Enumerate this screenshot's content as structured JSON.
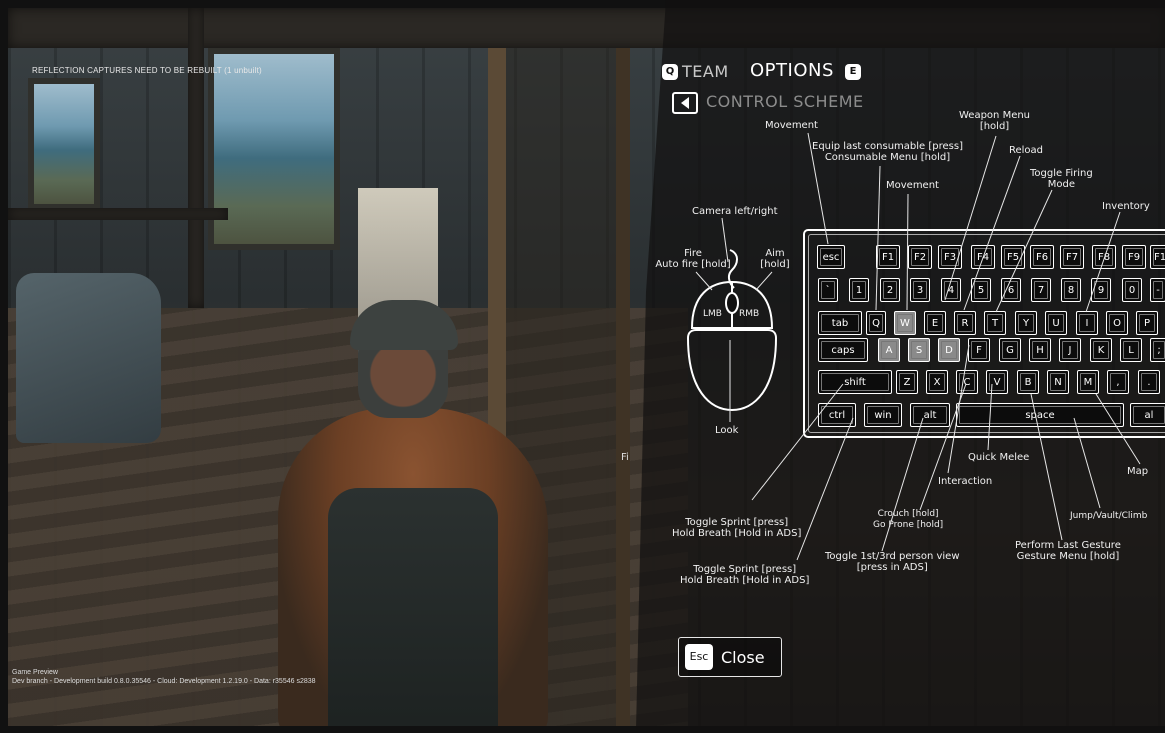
{
  "dev_overlay": {
    "top_warning": "REFLECTION CAPTURES NEED TO BE REBUILT (1 unbuilt)",
    "bottom_line1": "Game Preview",
    "bottom_line2": "Dev branch - Development build 0.8.0.35546 - Cloud: Development 1.2.19.0 - Data: r35546 s2838",
    "fragment_text": "Fi"
  },
  "header": {
    "team_key": "Q",
    "team_label": "TEAM",
    "options_label": "OPTIONS",
    "options_key": "E",
    "back_icon": "chevron-left-icon",
    "scheme_label": "CONTROL SCHEME"
  },
  "mouse": {
    "left_button": "LMB",
    "right_button": "RMB",
    "labels": {
      "camera": "Camera left/right",
      "fire_line1": "Fire",
      "fire_line2": "Auto fire [hold]",
      "aim_line1": "Aim",
      "aim_line2": "[hold]",
      "look": "Look"
    }
  },
  "keyboard": {
    "highlighted_keys": [
      "W",
      "A",
      "S",
      "D"
    ],
    "rows": {
      "fn": [
        "esc",
        "F1",
        "F2",
        "F3",
        "F4",
        "F5",
        "F6",
        "F7",
        "F8",
        "F9",
        "F1"
      ],
      "num": [
        "`",
        "1",
        "2",
        "3",
        "4",
        "5",
        "6",
        "7",
        "8",
        "9",
        "0",
        "-"
      ],
      "top": [
        "tab",
        "Q",
        "W",
        "E",
        "R",
        "T",
        "Y",
        "U",
        "I",
        "O",
        "P"
      ],
      "home": [
        "caps",
        "A",
        "S",
        "D",
        "F",
        "G",
        "H",
        "J",
        "K",
        "L",
        ";"
      ],
      "bottom": [
        "shift",
        "Z",
        "X",
        "C",
        "V",
        "B",
        "N",
        "M",
        ",",
        "."
      ],
      "space": [
        "ctrl",
        "win",
        "alt",
        "space",
        "al"
      ]
    }
  },
  "annotations": {
    "movement_top": "Movement",
    "equip_line1": "Equip last consumable [press]",
    "equip_line2": "Consumable Menu [hold]",
    "weapon_menu_line1": "Weapon Menu",
    "weapon_menu_line2": "[hold]",
    "reload": "Reload",
    "toggle_firing_line1": "Toggle Firing",
    "toggle_firing_line2": "Mode",
    "movement_mid": "Movement",
    "inventory": "Inventory",
    "quick_melee": "Quick Melee",
    "map": "Map",
    "interaction": "Interaction",
    "jump": "Jump/Vault/Climb",
    "toggle_sprint_a_line1": "Toggle Sprint [press]",
    "toggle_sprint_a_line2": "Hold Breath [Hold in ADS]",
    "crouch_line1": "Crouch [hold]",
    "crouch_line2": "Go Prone [hold]",
    "gesture_line1": "Perform Last Gesture",
    "gesture_line2": "Gesture Menu [hold]",
    "toggle_view_line1": "Toggle 1st/3rd person view",
    "toggle_view_line2": "[press in ADS]",
    "toggle_sprint_b_line1": "Toggle Sprint [press]",
    "toggle_sprint_b_line2": "Hold Breath [Hold in ADS]"
  },
  "footer": {
    "close_key": "Esc",
    "close_label": "Close"
  }
}
